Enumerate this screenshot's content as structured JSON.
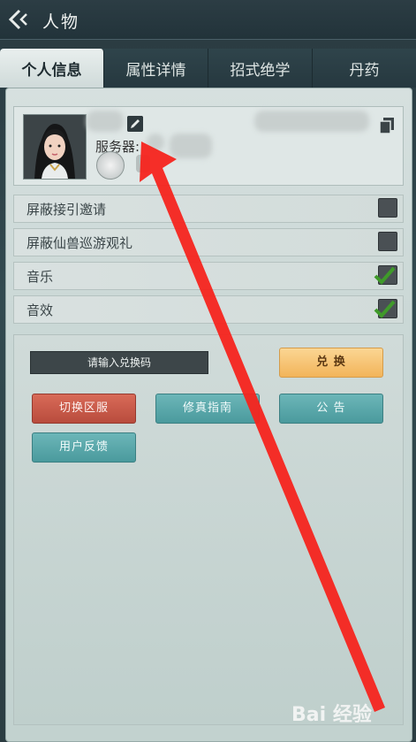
{
  "header": {
    "title": "人物"
  },
  "tabs": [
    {
      "label": "个人信息",
      "active": true
    },
    {
      "label": "属性详情",
      "active": false
    },
    {
      "label": "招式绝学",
      "active": false
    },
    {
      "label": "丹药",
      "active": false
    }
  ],
  "profile": {
    "server_label": "服务器:"
  },
  "settings": [
    {
      "label": "屏蔽接引邀请",
      "checked": false
    },
    {
      "label": "屏蔽仙兽巡游观礼",
      "checked": false
    },
    {
      "label": "音乐",
      "checked": true
    },
    {
      "label": "音效",
      "checked": true
    }
  ],
  "redeem": {
    "placeholder": "请输入兑换码",
    "button": "兑 换"
  },
  "buttons": {
    "switch_server": "切换区服",
    "guide": "修真指南",
    "notice": "公 告",
    "feedback": "用户反馈"
  },
  "watermark": "Bai 经验",
  "colors": {
    "accent_gold": "#f2b45a",
    "accent_red": "#b94c3d",
    "accent_teal": "#4a9a9d",
    "arrow": "#f5241e"
  }
}
